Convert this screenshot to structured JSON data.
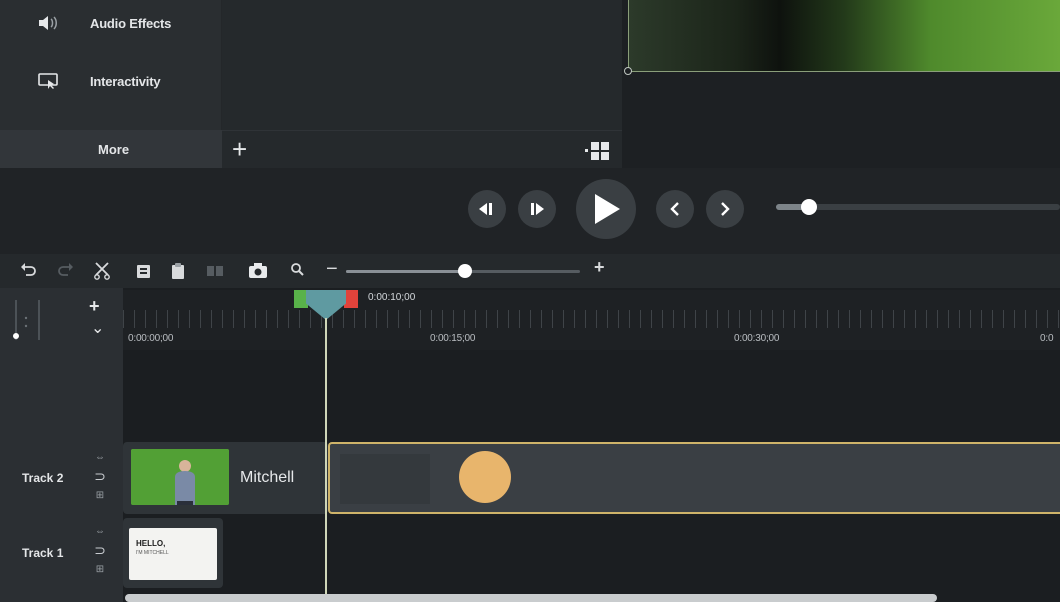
{
  "sidebar": {
    "items": [
      {
        "label": "Audio Effects",
        "icon": "speaker-icon"
      },
      {
        "label": "Interactivity",
        "icon": "interactivity-icon"
      }
    ],
    "more_label": "More"
  },
  "library": {
    "add_icon": "plus-icon",
    "view_icon": "grid-view-icon"
  },
  "playback": {
    "controls": [
      "step-back-icon",
      "step-forward-icon",
      "play-icon",
      "previous-icon",
      "next-icon"
    ],
    "scrub_progress": 0.09
  },
  "toolbar": {
    "tools": [
      "undo-icon",
      "redo-icon",
      "cut-icon",
      "copy-icon",
      "paste-icon",
      "split-icon",
      "camera-icon",
      "zoom-icon"
    ],
    "zoom_minus": "−",
    "zoom_plus": "+",
    "zoom_level": 0.5
  },
  "timeline": {
    "playhead_time": "0:00:10;00",
    "ruler_labels": [
      "0:00:00;00",
      "0:00:15;00",
      "0:00:30;00",
      "0:0"
    ],
    "tracks": [
      {
        "label": "Track 2",
        "clip_name": "Mitchell"
      },
      {
        "label": "Track 1",
        "clip_thumb_text": "HELLO,",
        "clip_thumb_subtext": "I'M MITCHELL"
      }
    ],
    "header_controls": {
      "add": "+",
      "collapse": "⌄"
    }
  },
  "colors": {
    "accent_circle": "#e8b56c",
    "clip_border": "#cfb46a",
    "playhead": "#5f9aa1",
    "in_marker": "#59b24a",
    "out_marker": "#e1433b"
  }
}
